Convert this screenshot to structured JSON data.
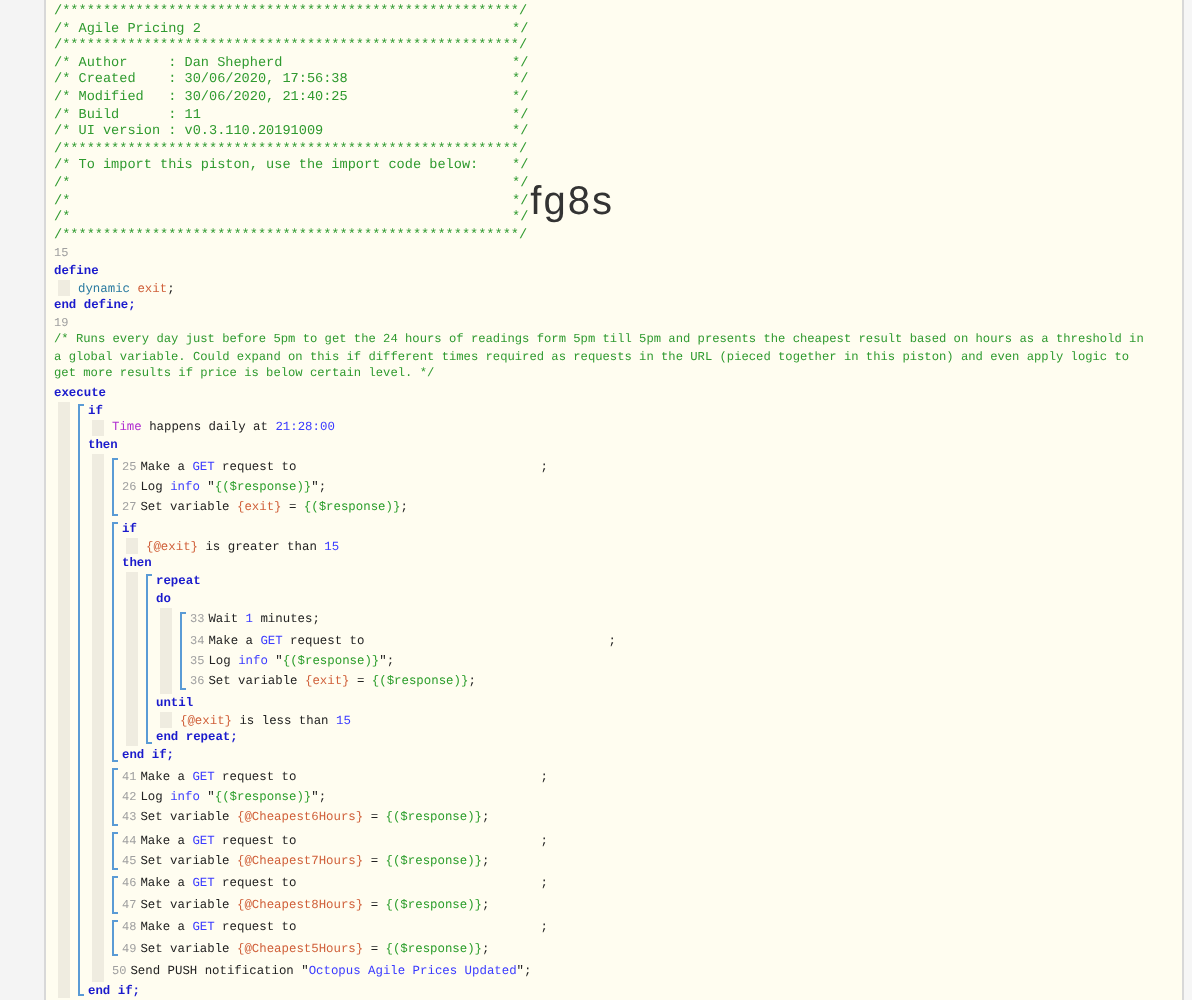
{
  "header": [
    {
      "text": "/********************************************************/"
    },
    {
      "text": "/* Agile Pricing 2",
      "close": "*/"
    },
    {
      "text": "/********************************************************/"
    },
    {
      "text": "/* Author     : Dan Shepherd",
      "close": "*/"
    },
    {
      "text": "/* Created    : 30/06/2020, 17:56:38",
      "close": "*/"
    },
    {
      "text": "/* Modified   : 30/06/2020, 21:40:25",
      "close": "*/"
    },
    {
      "text": "/* Build      : 11",
      "close": "*/"
    },
    {
      "text": "/* UI version : v0.3.110.20191009",
      "close": "*/"
    },
    {
      "text": "/********************************************************/"
    },
    {
      "text": "/* To import this piston, use the import code below:",
      "close": "*/"
    },
    {
      "text": "/*",
      "close": "*/"
    },
    {
      "text": "/*",
      "close": "*/",
      "import_code": "fg8s"
    },
    {
      "text": "/*",
      "close": "*/"
    },
    {
      "text": "/********************************************************/"
    }
  ],
  "code": [
    {
      "kind": "number",
      "number": "15"
    },
    {
      "kind": "line",
      "tokens": [
        {
          "kind": "keyword",
          "text": "define"
        }
      ],
      "children": [
        {
          "kind": "line",
          "tokens": [
            {
              "kind": "type",
              "text": "dynamic "
            },
            {
              "kind": "variable",
              "text": "exit"
            },
            {
              "kind": "plain",
              "text": ";"
            }
          ]
        }
      ]
    },
    {
      "kind": "line",
      "tokens": [
        {
          "kind": "keyword",
          "text": "end define;"
        }
      ]
    },
    {
      "kind": "number",
      "number": "19"
    },
    {
      "kind": "comment",
      "text": "/* Runs every day just before 5pm to get the 24 hours of readings form 5pm till 5pm and presents the cheapest result based on hours as a threshold in a global variable. Could expand on this if different times required as requests in the URL (pieced together in this piston) and even apply logic to get more results if price is below certain level. */"
    },
    {
      "kind": "line",
      "tokens": [
        {
          "kind": "keyword",
          "text": "execute"
        }
      ],
      "children": [
        {
          "kind": "block",
          "children": [
            {
              "kind": "line",
              "tokens": [
                {
                  "kind": "keyword",
                  "text": "if"
                }
              ],
              "children": [
                {
                  "kind": "line",
                  "tokens": [
                    {
                      "kind": "device",
                      "text": "Time"
                    },
                    {
                      "kind": "plain",
                      "text": " happens daily at "
                    },
                    {
                      "kind": "number",
                      "text": "21:28:00"
                    }
                  ]
                }
              ]
            },
            {
              "kind": "line",
              "tokens": [
                {
                  "kind": "keyword",
                  "text": "then"
                }
              ],
              "children": [
                {
                  "kind": "group",
                  "children": [
                    {
                      "kind": "line",
                      "number": "25",
                      "tail": ";",
                      "tokens": [
                        {
                          "kind": "plain",
                          "text": "Make a "
                        },
                        {
                          "kind": "reference",
                          "text": "GET"
                        },
                        {
                          "kind": "plain",
                          "text": " request to"
                        }
                      ]
                    },
                    {
                      "kind": "line",
                      "number": "26",
                      "tokens": [
                        {
                          "kind": "plain",
                          "text": "Log "
                        },
                        {
                          "kind": "reference",
                          "text": "info"
                        },
                        {
                          "kind": "plain",
                          "text": " \""
                        },
                        {
                          "kind": "string",
                          "text": "{($response)}"
                        },
                        {
                          "kind": "plain",
                          "text": "\";"
                        }
                      ]
                    },
                    {
                      "kind": "line",
                      "number": "27",
                      "tokens": [
                        {
                          "kind": "plain",
                          "text": "Set variable "
                        },
                        {
                          "kind": "variable",
                          "text": "{exit}"
                        },
                        {
                          "kind": "plain",
                          "text": " = "
                        },
                        {
                          "kind": "string",
                          "text": "{($response)}"
                        },
                        {
                          "kind": "plain",
                          "text": ";"
                        }
                      ]
                    }
                  ]
                },
                {
                  "kind": "block",
                  "children": [
                    {
                      "kind": "line",
                      "tokens": [
                        {
                          "kind": "keyword",
                          "text": "if"
                        }
                      ],
                      "children": [
                        {
                          "kind": "line",
                          "tokens": [
                            {
                              "kind": "variable",
                              "text": "{@exit}"
                            },
                            {
                              "kind": "plain",
                              "text": " is greater than "
                            },
                            {
                              "kind": "number",
                              "text": "15"
                            }
                          ]
                        }
                      ]
                    },
                    {
                      "kind": "line",
                      "tokens": [
                        {
                          "kind": "keyword",
                          "text": "then"
                        }
                      ],
                      "children": [
                        {
                          "kind": "block",
                          "children": [
                            {
                              "kind": "line",
                              "tokens": [
                                {
                                  "kind": "keyword",
                                  "text": "repeat"
                                }
                              ]
                            },
                            {
                              "kind": "line",
                              "tokens": [
                                {
                                  "kind": "keyword",
                                  "text": "do"
                                }
                              ],
                              "children": [
                                {
                                  "kind": "group",
                                  "children": [
                                    {
                                      "kind": "line",
                                      "number": "33",
                                      "tokens": [
                                        {
                                          "kind": "plain",
                                          "text": "Wait "
                                        },
                                        {
                                          "kind": "number",
                                          "text": "1"
                                        },
                                        {
                                          "kind": "plain",
                                          "text": " minutes;"
                                        }
                                      ]
                                    },
                                    {
                                      "kind": "line",
                                      "number": "34",
                                      "tail": ";",
                                      "tokens": [
                                        {
                                          "kind": "plain",
                                          "text": "Make a "
                                        },
                                        {
                                          "kind": "reference",
                                          "text": "GET"
                                        },
                                        {
                                          "kind": "plain",
                                          "text": " request to"
                                        }
                                      ]
                                    },
                                    {
                                      "kind": "line",
                                      "number": "35",
                                      "tokens": [
                                        {
                                          "kind": "plain",
                                          "text": "Log "
                                        },
                                        {
                                          "kind": "reference",
                                          "text": "info"
                                        },
                                        {
                                          "kind": "plain",
                                          "text": " \""
                                        },
                                        {
                                          "kind": "string",
                                          "text": "{($response)}"
                                        },
                                        {
                                          "kind": "plain",
                                          "text": "\";"
                                        }
                                      ]
                                    },
                                    {
                                      "kind": "line",
                                      "number": "36",
                                      "tokens": [
                                        {
                                          "kind": "plain",
                                          "text": "Set variable "
                                        },
                                        {
                                          "kind": "variable",
                                          "text": "{exit}"
                                        },
                                        {
                                          "kind": "plain",
                                          "text": " = "
                                        },
                                        {
                                          "kind": "string",
                                          "text": "{($response)}"
                                        },
                                        {
                                          "kind": "plain",
                                          "text": ";"
                                        }
                                      ]
                                    }
                                  ]
                                }
                              ]
                            },
                            {
                              "kind": "line",
                              "tokens": [
                                {
                                  "kind": "keyword",
                                  "text": "until"
                                }
                              ],
                              "children": [
                                {
                                  "kind": "line",
                                  "tokens": [
                                    {
                                      "kind": "variable",
                                      "text": "{@exit}"
                                    },
                                    {
                                      "kind": "plain",
                                      "text": " is less than "
                                    },
                                    {
                                      "kind": "number",
                                      "text": "15"
                                    }
                                  ]
                                }
                              ]
                            },
                            {
                              "kind": "line",
                              "tokens": [
                                {
                                  "kind": "keyword",
                                  "text": "end repeat;"
                                }
                              ]
                            }
                          ]
                        }
                      ]
                    },
                    {
                      "kind": "line",
                      "tokens": [
                        {
                          "kind": "keyword",
                          "text": "end if;"
                        }
                      ]
                    }
                  ]
                },
                {
                  "kind": "group",
                  "children": [
                    {
                      "kind": "line",
                      "number": "41",
                      "tail": ";",
                      "tokens": [
                        {
                          "kind": "plain",
                          "text": "Make a "
                        },
                        {
                          "kind": "reference",
                          "text": "GET"
                        },
                        {
                          "kind": "plain",
                          "text": " request to"
                        }
                      ]
                    },
                    {
                      "kind": "line",
                      "number": "42",
                      "tokens": [
                        {
                          "kind": "plain",
                          "text": "Log "
                        },
                        {
                          "kind": "reference",
                          "text": "info"
                        },
                        {
                          "kind": "plain",
                          "text": " \""
                        },
                        {
                          "kind": "string",
                          "text": "{($response)}"
                        },
                        {
                          "kind": "plain",
                          "text": "\";"
                        }
                      ]
                    },
                    {
                      "kind": "line",
                      "number": "43",
                      "tokens": [
                        {
                          "kind": "plain",
                          "text": "Set variable "
                        },
                        {
                          "kind": "variable",
                          "text": "{@Cheapest6Hours}"
                        },
                        {
                          "kind": "plain",
                          "text": " = "
                        },
                        {
                          "kind": "string",
                          "text": "{($response)}"
                        },
                        {
                          "kind": "plain",
                          "text": ";"
                        }
                      ]
                    }
                  ]
                },
                {
                  "kind": "group",
                  "children": [
                    {
                      "kind": "line",
                      "number": "44",
                      "tail": ";",
                      "tokens": [
                        {
                          "kind": "plain",
                          "text": "Make a "
                        },
                        {
                          "kind": "reference",
                          "text": "GET"
                        },
                        {
                          "kind": "plain",
                          "text": " request to"
                        }
                      ]
                    },
                    {
                      "kind": "line",
                      "number": "45",
                      "tokens": [
                        {
                          "kind": "plain",
                          "text": "Set variable "
                        },
                        {
                          "kind": "variable",
                          "text": "{@Cheapest7Hours}"
                        },
                        {
                          "kind": "plain",
                          "text": " = "
                        },
                        {
                          "kind": "string",
                          "text": "{($response)}"
                        },
                        {
                          "kind": "plain",
                          "text": ";"
                        }
                      ]
                    }
                  ]
                },
                {
                  "kind": "group",
                  "children": [
                    {
                      "kind": "line",
                      "number": "46",
                      "tail": ";",
                      "tokens": [
                        {
                          "kind": "plain",
                          "text": "Make a "
                        },
                        {
                          "kind": "reference",
                          "text": "GET"
                        },
                        {
                          "kind": "plain",
                          "text": " request to"
                        }
                      ]
                    },
                    {
                      "kind": "line",
                      "number": "47",
                      "tokens": [
                        {
                          "kind": "plain",
                          "text": "Set variable "
                        },
                        {
                          "kind": "variable",
                          "text": "{@Cheapest8Hours}"
                        },
                        {
                          "kind": "plain",
                          "text": " = "
                        },
                        {
                          "kind": "string",
                          "text": "{($response)}"
                        },
                        {
                          "kind": "plain",
                          "text": ";"
                        }
                      ]
                    }
                  ]
                },
                {
                  "kind": "group",
                  "children": [
                    {
                      "kind": "line",
                      "number": "48",
                      "tail": ";",
                      "tokens": [
                        {
                          "kind": "plain",
                          "text": "Make a "
                        },
                        {
                          "kind": "reference",
                          "text": "GET"
                        },
                        {
                          "kind": "plain",
                          "text": " request to"
                        }
                      ]
                    },
                    {
                      "kind": "line",
                      "number": "49",
                      "tokens": [
                        {
                          "kind": "plain",
                          "text": "Set variable "
                        },
                        {
                          "kind": "variable",
                          "text": "{@Cheapest5Hours}"
                        },
                        {
                          "kind": "plain",
                          "text": " = "
                        },
                        {
                          "kind": "string",
                          "text": "{($response)}"
                        },
                        {
                          "kind": "plain",
                          "text": ";"
                        }
                      ]
                    }
                  ]
                },
                {
                  "kind": "line",
                  "number": "50",
                  "tokens": [
                    {
                      "kind": "plain",
                      "text": "Send PUSH notification \""
                    },
                    {
                      "kind": "reference",
                      "text": "Octopus Agile Prices Updated"
                    },
                    {
                      "kind": "plain",
                      "text": "\";"
                    }
                  ]
                }
              ]
            },
            {
              "kind": "line",
              "tokens": [
                {
                  "kind": "keyword",
                  "text": "end if;"
                }
              ]
            }
          ]
        }
      ]
    }
  ]
}
